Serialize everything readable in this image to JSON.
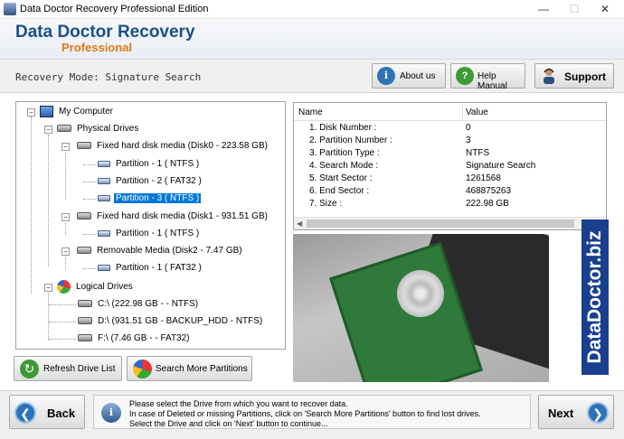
{
  "window": {
    "title": "Data Doctor Recovery Professional Edition",
    "min": "—",
    "max": "☐",
    "close": "✕"
  },
  "header": {
    "brand": "Data Doctor Recovery",
    "edition": "Professional"
  },
  "modebar": {
    "mode_text": "Recovery Mode: Signature Search",
    "about_label": "About us",
    "help_label": "Help Manual",
    "support_label": "Support"
  },
  "tree": {
    "root": "My Computer",
    "physical": "Physical Drives",
    "disk0": "Fixed hard disk media (Disk0 - 223.58 GB)",
    "disk0_parts": [
      "Partition - 1 ( NTFS )",
      "Partition - 2 ( FAT32 )",
      "Partition - 3 ( NTFS )"
    ],
    "disk1": "Fixed hard disk media (Disk1 - 931.51 GB)",
    "disk1_parts": [
      "Partition - 1 ( NTFS )"
    ],
    "disk2": "Removable Media (Disk2 - 7.47 GB)",
    "disk2_parts": [
      "Partition - 1 ( FAT32 )"
    ],
    "logical": "Logical Drives",
    "logical_items": [
      "C:\\ (222.98 GB -  - NTFS)",
      "D:\\ (931.51 GB - BACKUP_HDD - NTFS)",
      "F:\\ (7.46 GB -  - FAT32)"
    ]
  },
  "props": {
    "col_name": "Name",
    "col_value": "Value",
    "rows": [
      {
        "name": "1. Disk Number :",
        "value": "0"
      },
      {
        "name": "2. Partition Number :",
        "value": "3"
      },
      {
        "name": "3. Partition Type :",
        "value": "NTFS"
      },
      {
        "name": "4. Search Mode :",
        "value": "Signature Search"
      },
      {
        "name": "5. Start Sector :",
        "value": "1261568"
      },
      {
        "name": "6. End Sector :",
        "value": "468875263"
      },
      {
        "name": "7. Size :",
        "value": "222.98 GB"
      }
    ]
  },
  "side_logo": "DataDoctor.biz",
  "actions": {
    "refresh_label": "Refresh Drive List",
    "search_label": "Search More Partitions"
  },
  "info": {
    "line1": "Please select the Drive from which you want to recover data.",
    "line2": "In case of Deleted or missing Partitions, click on 'Search More Partitions' button to find lost drives.",
    "line3": "Select the Drive and click on 'Next' button to continue..."
  },
  "nav": {
    "back_label": "Back",
    "next_label": "Next"
  }
}
